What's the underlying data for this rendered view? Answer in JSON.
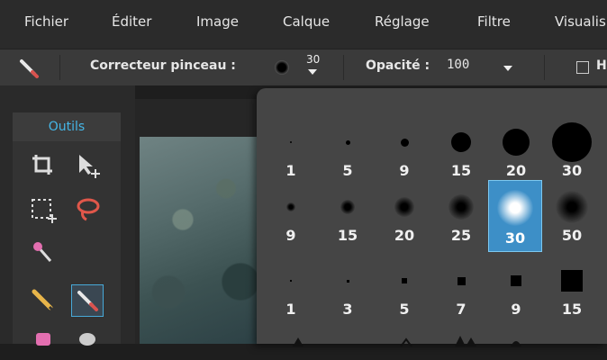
{
  "menu": {
    "items": [
      "Fichier",
      "Éditer",
      "Image",
      "Calque",
      "Réglage",
      "Filtre",
      "Visualis"
    ]
  },
  "toolbar": {
    "brush_label": "Correcteur pinceau :",
    "brush_size": "30",
    "opacity_label": "Opacité :",
    "opacity_value": "100",
    "checkbox_partial": "H"
  },
  "tools_panel": {
    "title": "Outils"
  },
  "brush_picker": {
    "rows": [
      {
        "kind": "hard",
        "sizes": [
          "1",
          "5",
          "9",
          "15",
          "20",
          "30"
        ]
      },
      {
        "kind": "soft",
        "sizes": [
          "9",
          "15",
          "20",
          "25",
          "30",
          "50"
        ]
      },
      {
        "kind": "square",
        "sizes": [
          "1",
          "3",
          "5",
          "7",
          "9",
          "15"
        ]
      }
    ],
    "selected": "soft-30"
  },
  "colors": {
    "accent": "#45b6e6",
    "selected_bg": "#3d8fc7",
    "menubar_bg": "#2b2b2b",
    "toolbar_bg": "#3a3a3a",
    "popup_bg": "#454545"
  }
}
